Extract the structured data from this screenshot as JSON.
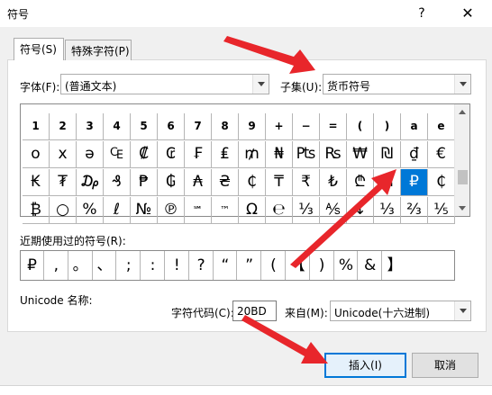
{
  "window": {
    "title": "符号",
    "help_label": "?",
    "close_label": "✕"
  },
  "tabs": [
    {
      "label": "符号(S)",
      "active": true
    },
    {
      "label": "特殊字符(P)",
      "active": false
    }
  ],
  "font": {
    "label": "字体(F):",
    "value": "(普通文本)"
  },
  "subset": {
    "label": "子集(U):",
    "value": "货币符号"
  },
  "symbol_grid": {
    "rows": [
      [
        "1",
        "2",
        "3",
        "4",
        "5",
        "6",
        "7",
        "8",
        "9",
        "+",
        "−",
        "=",
        "(",
        ")",
        "a",
        "e"
      ],
      [
        "o",
        "x",
        "ə",
        "₠",
        "₡",
        "₢",
        "₣",
        "₤",
        "₥",
        "₦",
        "₧",
        "₨",
        "₩",
        "₪",
        "₫",
        "€"
      ],
      [
        "₭",
        "₮",
        "₯",
        "₰",
        "₱",
        "₲",
        "₳",
        "₴",
        "₵",
        "₸",
        "₹",
        "₺",
        "₾",
        "₼",
        "₽",
        "₵"
      ],
      [
        "₿",
        "○",
        "%",
        "ℓ",
        "№",
        "℗",
        "℠",
        "™",
        "Ω",
        "℮",
        "⅓",
        "⅍",
        "↓",
        "⅓",
        "⅔",
        "⅕"
      ]
    ],
    "selected": "₽"
  },
  "recent": {
    "label": "近期使用过的符号(R):",
    "symbols": [
      "₽",
      ",",
      "。",
      "、",
      ";",
      ":",
      "!",
      "?",
      "“",
      "”",
      "(",
      "【",
      ")",
      "%",
      "&",
      "】"
    ]
  },
  "unicode_name": {
    "label": "Unicode 名称:"
  },
  "char_code": {
    "label": "字符代码(C):",
    "value": "20BD"
  },
  "from": {
    "label": "来自(M):",
    "value": "Unicode(十六进制)"
  },
  "buttons": {
    "insert": "插入(I)",
    "cancel": "取消"
  },
  "colors": {
    "selection": "#0078d7",
    "arrow": "#e8262b"
  }
}
